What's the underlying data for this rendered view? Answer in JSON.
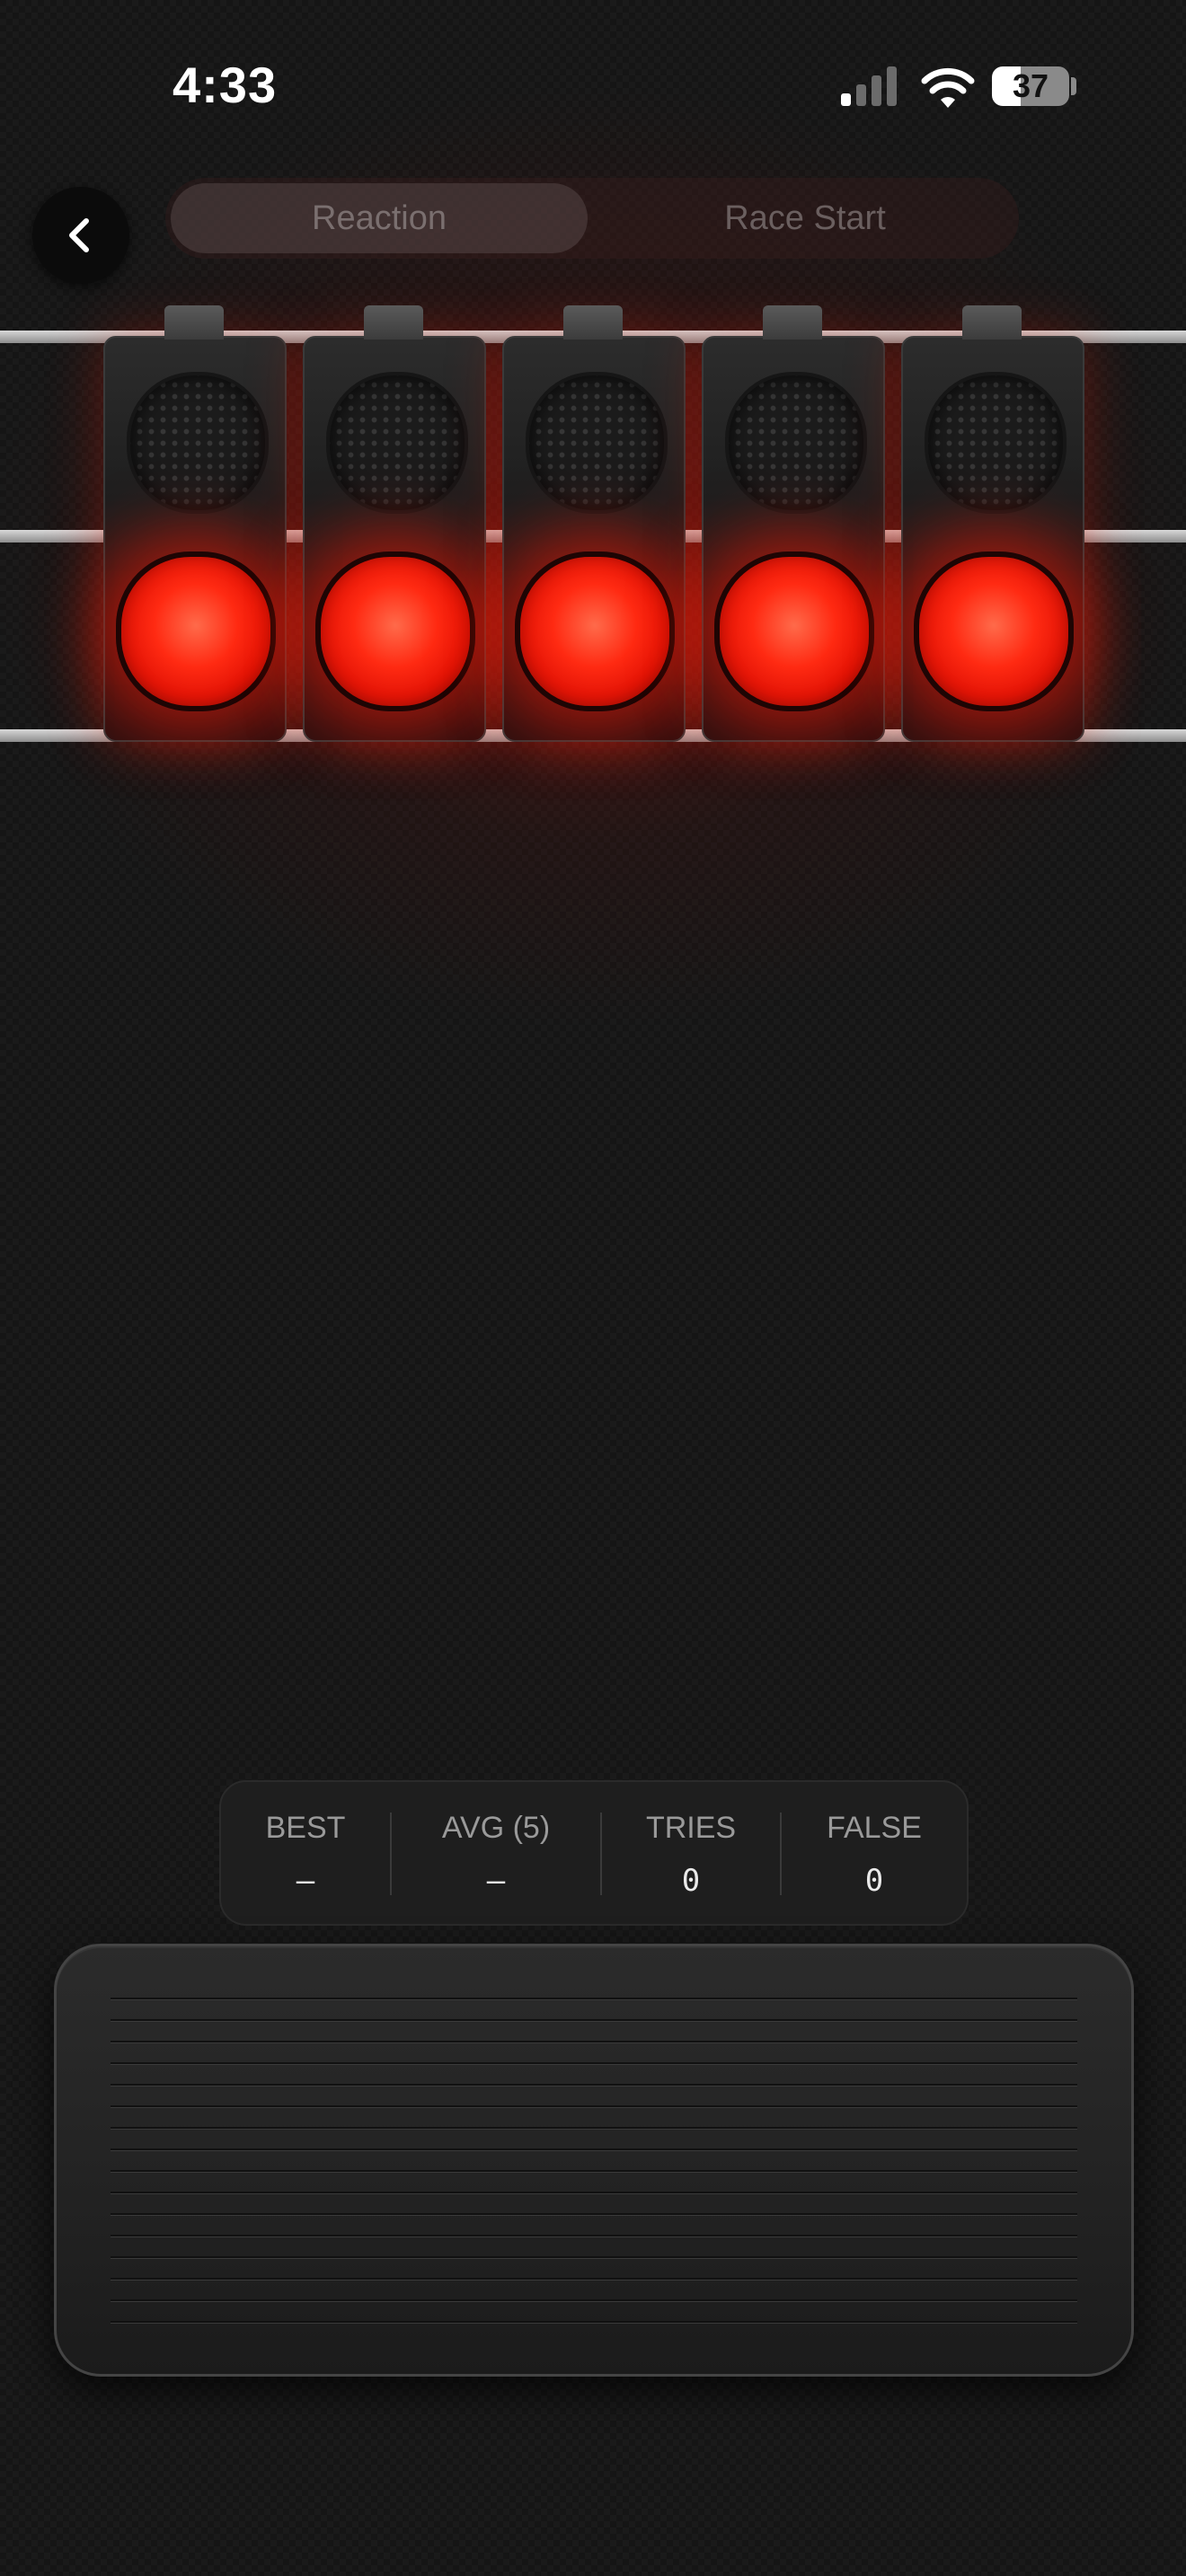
{
  "status_bar": {
    "time": "4:33",
    "battery": "37",
    "icons": [
      "cellular-signal-icon",
      "wifi-icon",
      "battery-icon"
    ]
  },
  "header": {
    "back_icon": "chevron-left-icon",
    "tabs": [
      {
        "label": "Reaction",
        "selected": true
      },
      {
        "label": "Race Start",
        "selected": false
      }
    ]
  },
  "lights": {
    "count": 5,
    "lit": [
      true,
      true,
      true,
      true,
      true
    ],
    "lit_color": "#ff2a12"
  },
  "stats": [
    {
      "label": "BEST",
      "value": "—"
    },
    {
      "label": "AVG (5)",
      "value": "—"
    },
    {
      "label": "TRIES",
      "value": "0"
    },
    {
      "label": "FALSE",
      "value": "0"
    }
  ],
  "colors": {
    "background": "#151515",
    "accent_red": "#e41406",
    "panel": "#1e1e1e"
  }
}
